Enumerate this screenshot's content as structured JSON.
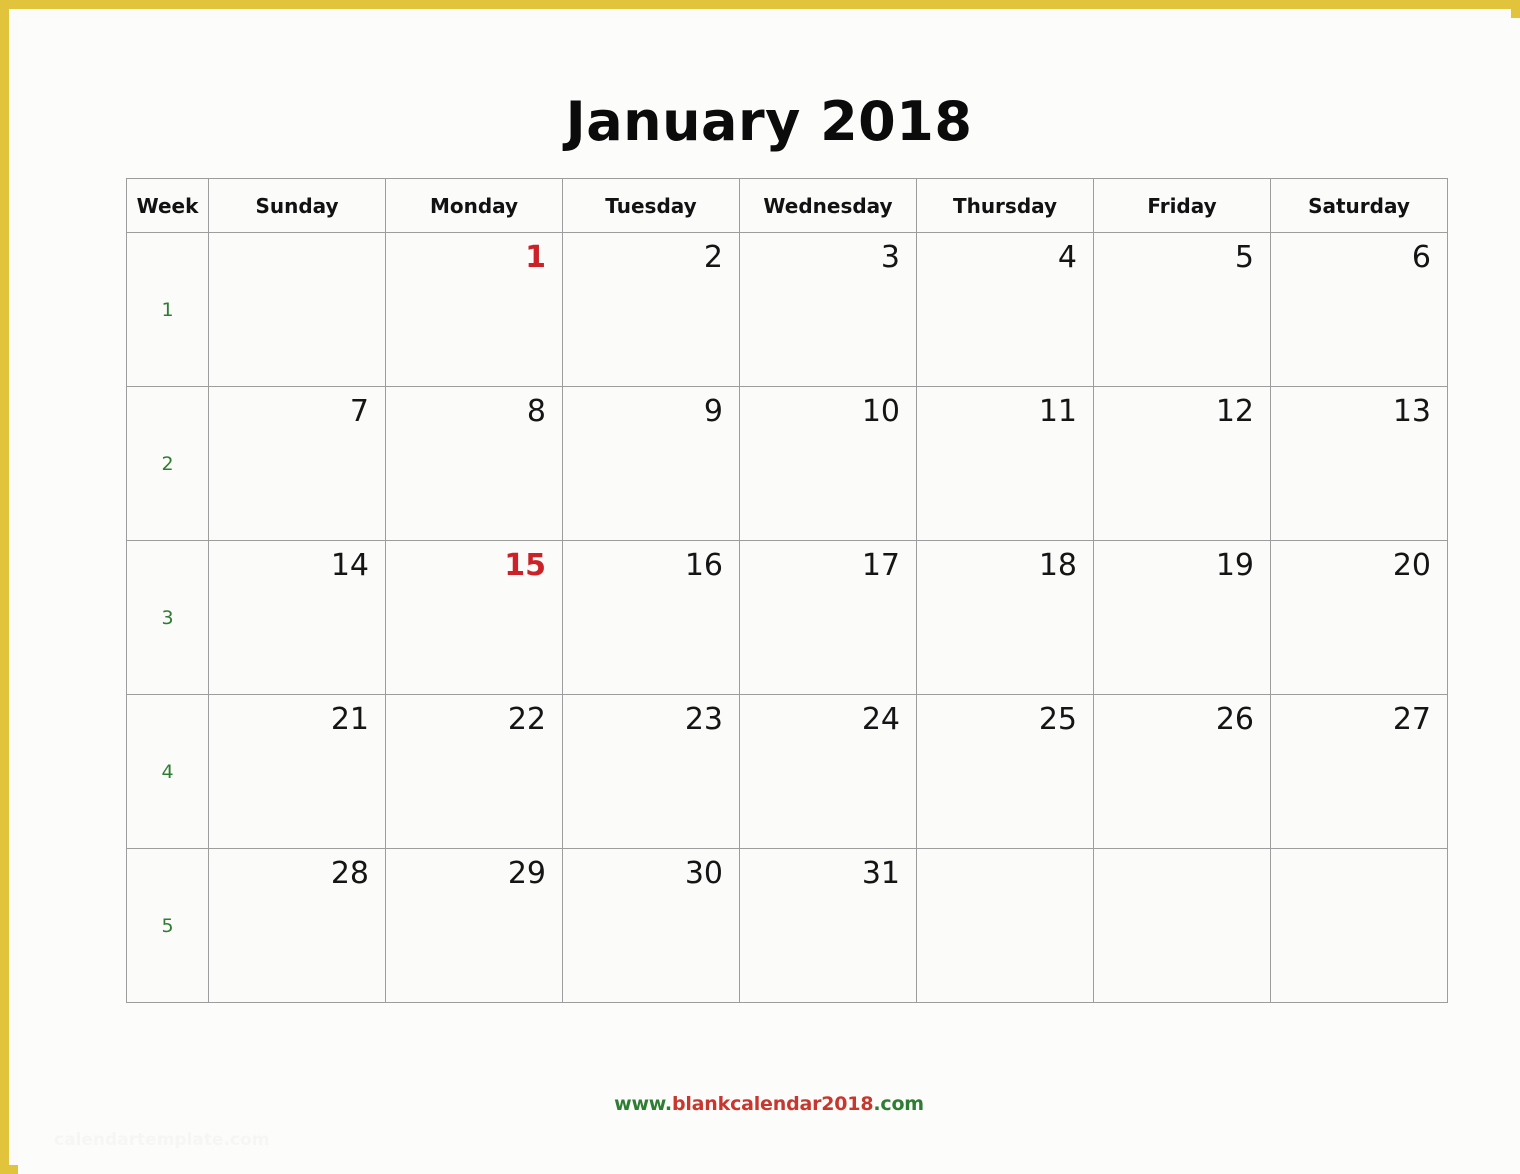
{
  "document": {
    "title": "January 2018",
    "month": "January",
    "year": "2018"
  },
  "colors": {
    "page_border": "#e2c43c",
    "header_bg": "#ebebeb",
    "grid_line": "#9d9d9d",
    "holiday_text": "#cc2127",
    "week_number_text": "#2e7d32",
    "day_text": "#151515",
    "footer_green": "#2e7d32",
    "footer_red": "#c8372d"
  },
  "table": {
    "headers": [
      "Week",
      "Sunday",
      "Monday",
      "Tuesday",
      "Wednesday",
      "Thursday",
      "Friday",
      "Saturday"
    ],
    "rows": [
      {
        "week": "1",
        "days": [
          {
            "num": "",
            "holiday": false
          },
          {
            "num": "1",
            "holiday": true
          },
          {
            "num": "2",
            "holiday": false
          },
          {
            "num": "3",
            "holiday": false
          },
          {
            "num": "4",
            "holiday": false
          },
          {
            "num": "5",
            "holiday": false
          },
          {
            "num": "6",
            "holiday": false
          }
        ]
      },
      {
        "week": "2",
        "days": [
          {
            "num": "7",
            "holiday": false
          },
          {
            "num": "8",
            "holiday": false
          },
          {
            "num": "9",
            "holiday": false
          },
          {
            "num": "10",
            "holiday": false
          },
          {
            "num": "11",
            "holiday": false
          },
          {
            "num": "12",
            "holiday": false
          },
          {
            "num": "13",
            "holiday": false
          }
        ]
      },
      {
        "week": "3",
        "days": [
          {
            "num": "14",
            "holiday": false
          },
          {
            "num": "15",
            "holiday": true
          },
          {
            "num": "16",
            "holiday": false
          },
          {
            "num": "17",
            "holiday": false
          },
          {
            "num": "18",
            "holiday": false
          },
          {
            "num": "19",
            "holiday": false
          },
          {
            "num": "20",
            "holiday": false
          }
        ]
      },
      {
        "week": "4",
        "days": [
          {
            "num": "21",
            "holiday": false
          },
          {
            "num": "22",
            "holiday": false
          },
          {
            "num": "23",
            "holiday": false
          },
          {
            "num": "24",
            "holiday": false
          },
          {
            "num": "25",
            "holiday": false
          },
          {
            "num": "26",
            "holiday": false
          },
          {
            "num": "27",
            "holiday": false
          }
        ]
      },
      {
        "week": "5",
        "days": [
          {
            "num": "28",
            "holiday": false
          },
          {
            "num": "29",
            "holiday": false
          },
          {
            "num": "30",
            "holiday": false
          },
          {
            "num": "31",
            "holiday": false
          },
          {
            "num": "",
            "holiday": false
          },
          {
            "num": "",
            "holiday": false
          },
          {
            "num": "",
            "holiday": false
          }
        ]
      }
    ]
  },
  "footer": {
    "segments": [
      {
        "text": "www.",
        "color": "green"
      },
      {
        "text": "blankcalendar2018",
        "color": "red"
      },
      {
        "text": ".com",
        "color": "green"
      }
    ],
    "full_text": "www.blankcalendar2018.com"
  },
  "watermark": {
    "text": "calendartemplate.com"
  }
}
